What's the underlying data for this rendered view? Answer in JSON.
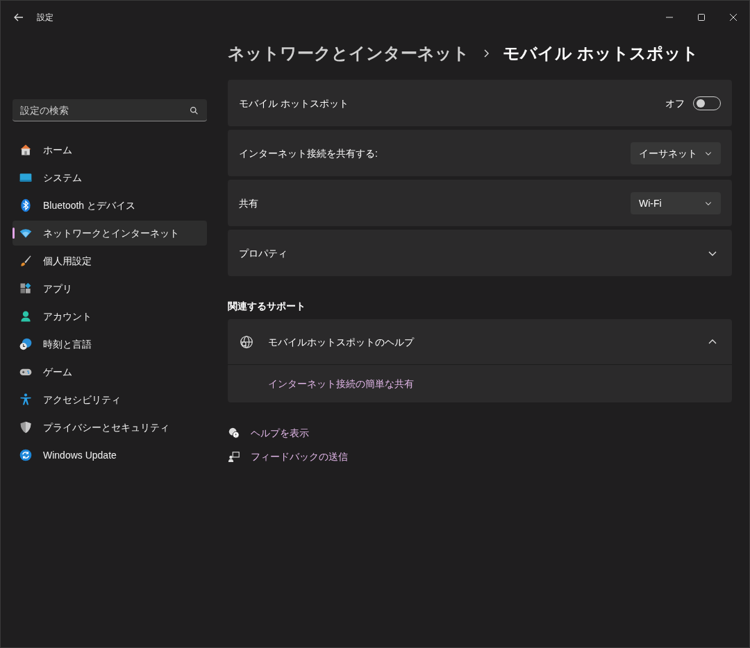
{
  "window": {
    "title": "設定"
  },
  "search": {
    "placeholder": "設定の検索"
  },
  "sidebar": {
    "items": [
      {
        "label": "ホーム",
        "selected": false
      },
      {
        "label": "システム",
        "selected": false
      },
      {
        "label": "Bluetooth とデバイス",
        "selected": false
      },
      {
        "label": "ネットワークとインターネット",
        "selected": true
      },
      {
        "label": "個人用設定",
        "selected": false
      },
      {
        "label": "アプリ",
        "selected": false
      },
      {
        "label": "アカウント",
        "selected": false
      },
      {
        "label": "時刻と言語",
        "selected": false
      },
      {
        "label": "ゲーム",
        "selected": false
      },
      {
        "label": "アクセシビリティ",
        "selected": false
      },
      {
        "label": "プライバシーとセキュリティ",
        "selected": false
      },
      {
        "label": "Windows Update",
        "selected": false
      }
    ]
  },
  "breadcrumb": {
    "parent": "ネットワークとインターネット",
    "current": "モバイル ホットスポット"
  },
  "settings": [
    {
      "kind": "toggle",
      "label": "モバイル ホットスポット",
      "state_label": "オフ",
      "on": false
    },
    {
      "kind": "dropdown",
      "label": "インターネット接続を共有する:",
      "value": "イーサネット"
    },
    {
      "kind": "dropdown",
      "label": "共有",
      "value": "Wi-Fi"
    },
    {
      "kind": "expander",
      "label": "プロパティ",
      "expanded": false
    }
  ],
  "related": {
    "heading": "関連するサポート",
    "title": "モバイルホットスポットのヘルプ",
    "expanded": true,
    "links": [
      "インターネット接続の簡単な共有"
    ]
  },
  "footer_links": [
    "ヘルプを表示",
    "フィードバックの送信"
  ]
}
